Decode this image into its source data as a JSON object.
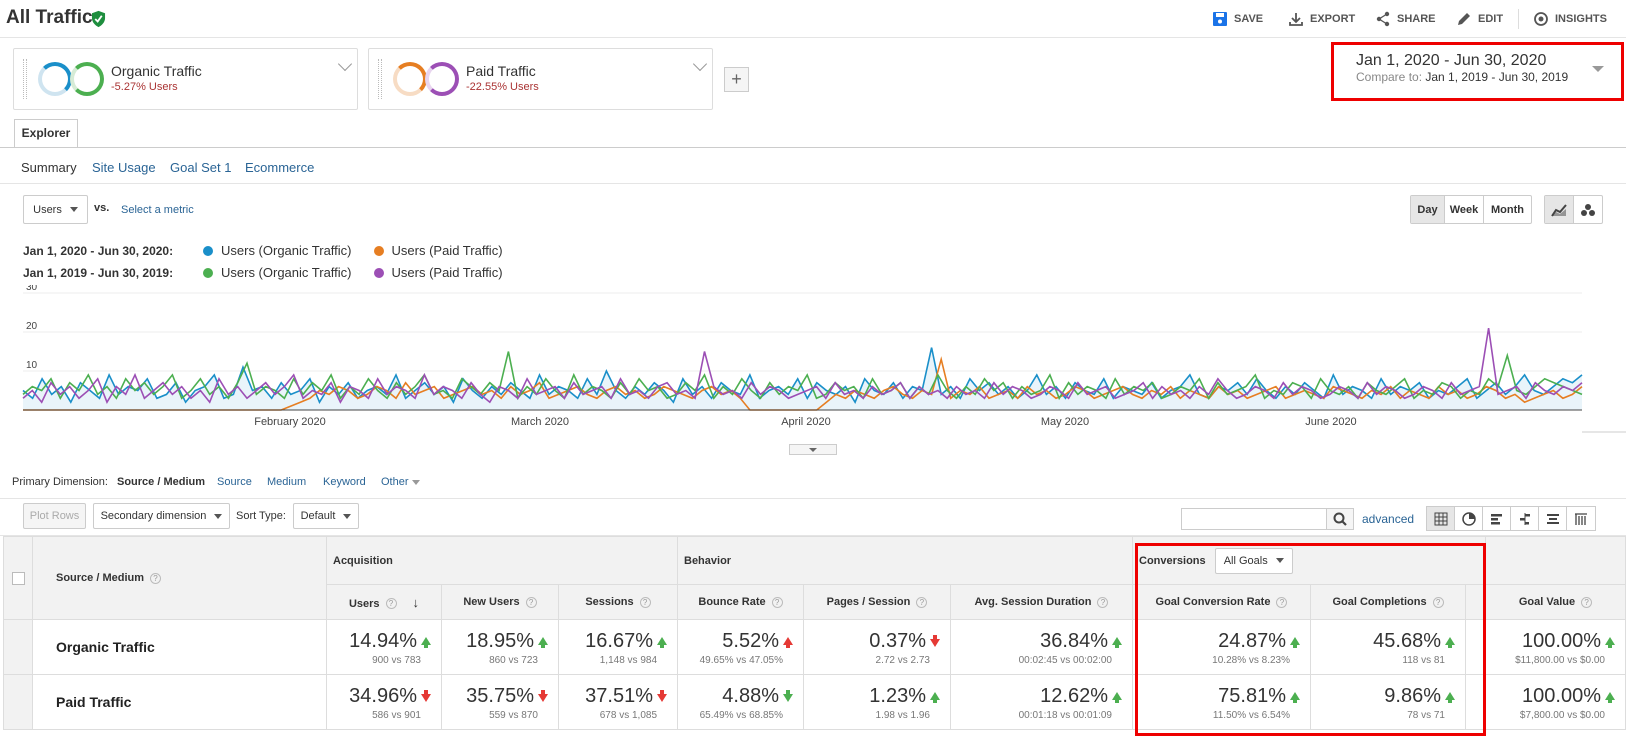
{
  "header": {
    "title": "All Traffic",
    "actions": [
      {
        "label": "SAVE",
        "icon": "save-icon"
      },
      {
        "label": "EXPORT",
        "icon": "export-icon"
      },
      {
        "label": "SHARE",
        "icon": "share-icon"
      },
      {
        "label": "EDIT",
        "icon": "edit-icon"
      },
      {
        "label": "INSIGHTS",
        "icon": "insights-icon"
      }
    ]
  },
  "segments": [
    {
      "name": "Organic Traffic",
      "delta": "-5.27% Users",
      "colors": [
        "#1a8fc9",
        "#4caf50"
      ]
    },
    {
      "name": "Paid Traffic",
      "delta": "-22.55% Users",
      "colors": [
        "#e67e22",
        "#9c4fb5"
      ]
    }
  ],
  "add_segment": "+",
  "date_range": {
    "primary": "Jan 1, 2020 - Jun 30, 2020",
    "compare_label": "Compare to:",
    "compare": "Jan 1, 2019 - Jun 30, 2019"
  },
  "explorer_tab": "Explorer",
  "subtabs": [
    "Summary",
    "Site Usage",
    "Goal Set 1",
    "Ecommerce"
  ],
  "metric_select": "Users",
  "vs_label": "vs.",
  "select_metric": "Select a metric",
  "granularity": [
    "Day",
    "Week",
    "Month"
  ],
  "legend": [
    {
      "range": "Jan 1, 2020 - Jun 30, 2020:",
      "items": [
        {
          "label": "Users (Organic Traffic)",
          "color": "#1a8fc9"
        },
        {
          "label": "Users (Paid Traffic)",
          "color": "#e67e22"
        }
      ]
    },
    {
      "range": "Jan 1, 2019 - Jun 30, 2019:",
      "items": [
        {
          "label": "Users (Organic Traffic)",
          "color": "#4caf50"
        },
        {
          "label": "Users (Paid Traffic)",
          "color": "#9c4fb5"
        }
      ]
    }
  ],
  "chart_data": {
    "type": "line",
    "ylim": [
      0,
      30
    ],
    "yticks": [
      "30",
      "20",
      "10"
    ],
    "x_labels": [
      "February 2020",
      "March 2020",
      "April 2020",
      "May 2020",
      "June 2020"
    ],
    "series": [
      {
        "name": "Users (Organic Traffic)",
        "color": "#1a8fc9",
        "values": [
          5,
          3,
          8,
          4,
          6,
          2,
          7,
          5,
          3,
          9,
          4,
          6,
          5,
          8,
          3,
          4,
          7,
          2,
          5,
          6,
          9,
          3,
          4,
          11,
          5,
          6,
          3,
          7,
          4,
          5,
          8,
          2,
          6,
          4,
          7,
          3,
          5,
          6,
          4,
          9,
          3,
          5,
          7,
          4,
          6,
          2,
          8,
          5,
          3,
          6,
          4,
          7,
          5,
          3,
          9,
          4,
          6,
          5,
          3,
          8,
          4,
          10,
          5,
          3,
          6,
          4,
          7,
          5,
          2,
          8,
          4,
          6,
          3,
          7,
          5,
          4,
          9,
          3,
          5,
          6,
          4,
          8,
          3,
          7,
          5,
          4,
          6,
          2,
          8,
          5,
          4,
          7,
          3,
          6,
          5,
          16,
          4,
          6,
          3,
          8,
          5,
          7,
          4,
          6,
          3,
          5,
          9,
          4,
          6,
          3,
          7,
          5,
          4,
          8,
          3,
          6,
          5,
          4,
          7,
          3,
          5,
          6,
          9,
          4,
          3,
          6,
          5,
          7,
          4,
          8,
          5,
          3,
          6,
          4,
          7,
          5,
          3,
          9,
          4,
          6,
          5,
          3,
          8,
          4,
          6,
          5,
          7,
          3,
          5,
          4,
          6,
          8,
          3,
          5,
          7,
          4,
          6,
          9,
          5,
          4,
          6,
          8,
          7,
          9
        ]
      },
      {
        "name": "Users (Paid Traffic)",
        "color": "#e67e22",
        "values": [
          0,
          0,
          0,
          0,
          0,
          0,
          0,
          0,
          0,
          0,
          0,
          0,
          0,
          0,
          0,
          0,
          0,
          0,
          0,
          0,
          0,
          0,
          0,
          0,
          0,
          0,
          0,
          0,
          1,
          2,
          3,
          5,
          4,
          6,
          5,
          3,
          4,
          6,
          5,
          3,
          7,
          4,
          5,
          6,
          3,
          4,
          5,
          6,
          4,
          5,
          3,
          6,
          4,
          5,
          7,
          3,
          4,
          5,
          6,
          4,
          3,
          5,
          6,
          4,
          5,
          3,
          4,
          6,
          5,
          4,
          3,
          5,
          6,
          4,
          5,
          3,
          0,
          0,
          0,
          0,
          0,
          0,
          0,
          0,
          2,
          4,
          3,
          5,
          4,
          3,
          5,
          6,
          4,
          3,
          5,
          4,
          13,
          3,
          5,
          4,
          6,
          3,
          4,
          5,
          3,
          6,
          4,
          5,
          3,
          4,
          6,
          5,
          3,
          4,
          5,
          6,
          4,
          3,
          5,
          4,
          6,
          3,
          5,
          4,
          3,
          6,
          4,
          5,
          3,
          4,
          5,
          6,
          3,
          4,
          5,
          4,
          3,
          6,
          5,
          4,
          3,
          5,
          4,
          6,
          3,
          5,
          4,
          3,
          6,
          4,
          5,
          3,
          4,
          6,
          5,
          3,
          4,
          2,
          3,
          4,
          5,
          3,
          4,
          6
        ]
      },
      {
        "name": "Users (Organic Traffic)",
        "color": "#4caf50",
        "values": [
          4,
          6,
          5,
          8,
          3,
          7,
          5,
          9,
          4,
          6,
          3,
          8,
          5,
          7,
          4,
          6,
          9,
          3,
          5,
          8,
          4,
          6,
          3,
          7,
          12,
          4,
          6,
          5,
          3,
          8,
          4,
          7,
          5,
          9,
          3,
          6,
          4,
          8,
          5,
          3,
          7,
          4,
          6,
          9,
          4,
          5,
          3,
          8,
          6,
          4,
          7,
          5,
          15,
          3,
          6,
          4,
          8,
          5,
          3,
          9,
          4,
          6,
          5,
          3,
          7,
          4,
          8,
          5,
          6,
          3,
          4,
          7,
          5,
          9,
          3,
          6,
          4,
          8,
          5,
          3,
          7,
          4,
          6,
          5,
          9,
          3,
          4,
          7,
          5,
          6,
          3,
          8,
          4,
          5,
          7,
          3,
          6,
          4,
          9,
          5,
          3,
          6,
          4,
          8,
          5,
          7,
          3,
          6,
          4,
          5,
          9,
          3,
          7,
          4,
          6,
          5,
          3,
          8,
          4,
          6,
          5,
          7,
          3,
          4,
          6,
          5,
          8,
          3,
          7,
          4,
          5,
          6,
          9,
          3,
          5,
          4,
          7,
          6,
          3,
          8,
          5,
          4,
          6,
          3,
          7,
          5,
          4,
          6,
          8,
          3,
          5,
          4,
          7,
          6,
          3,
          5,
          4,
          8,
          6,
          14,
          5,
          4,
          6,
          8,
          7,
          6,
          5,
          4
        ]
      },
      {
        "name": "Users (Paid Traffic)",
        "color": "#9c4fb5",
        "values": [
          3,
          5,
          2,
          7,
          4,
          6,
          3,
          5,
          8,
          2,
          6,
          4,
          9,
          3,
          5,
          7,
          4,
          6,
          3,
          5,
          2,
          8,
          4,
          6,
          3,
          5,
          7,
          4,
          6,
          9,
          3,
          5,
          4,
          7,
          2,
          6,
          5,
          3,
          8,
          4,
          6,
          5,
          3,
          9,
          4,
          6,
          5,
          3,
          7,
          4,
          2,
          6,
          5,
          3,
          8,
          4,
          5,
          6,
          3,
          7,
          4,
          5,
          6,
          3,
          8,
          4,
          5,
          3,
          6,
          7,
          4,
          5,
          3,
          15,
          6,
          4,
          5,
          3,
          7,
          4,
          6,
          5,
          3,
          4,
          5,
          6,
          3,
          7,
          4,
          5,
          3,
          6,
          4,
          5,
          7,
          3,
          6,
          4,
          5,
          3,
          6,
          4,
          5,
          3,
          7,
          4,
          6,
          5,
          3,
          4,
          6,
          5,
          3,
          7,
          4,
          5,
          6,
          3,
          4,
          5,
          7,
          3,
          6,
          4,
          5,
          3,
          6,
          4,
          8,
          5,
          3,
          4,
          6,
          5,
          3,
          7,
          4,
          6,
          5,
          3,
          4,
          6,
          5,
          3,
          7,
          4,
          6,
          5,
          3,
          4,
          6,
          5,
          3,
          7,
          4,
          5,
          6,
          21,
          4,
          5,
          6,
          3,
          7,
          5,
          4,
          6,
          5,
          7
        ]
      }
    ]
  },
  "primary_dimension": {
    "label": "Primary Dimension:",
    "active": "Source / Medium",
    "options": [
      "Source",
      "Medium",
      "Keyword",
      "Other"
    ]
  },
  "table_controls": {
    "plot_rows": "Plot Rows",
    "secondary_dimension": "Secondary dimension",
    "sort_type_label": "Sort Type:",
    "sort_type": "Default",
    "advanced": "advanced"
  },
  "table": {
    "dimension_header": "Source / Medium",
    "group_acquisition": "Acquisition",
    "group_behavior": "Behavior",
    "group_conversions": "Conversions",
    "goal_select": "All Goals",
    "columns": [
      "Users",
      "New Users",
      "Sessions",
      "Bounce Rate",
      "Pages / Session",
      "Avg. Session Duration",
      "Goal Conversion Rate",
      "Goal Completions",
      "Goal Value"
    ],
    "rows": [
      {
        "name": "Organic Traffic",
        "cells": [
          {
            "pct": "14.94%",
            "dir": "up",
            "sub": "900 vs 783"
          },
          {
            "pct": "18.95%",
            "dir": "up",
            "sub": "860 vs 723"
          },
          {
            "pct": "16.67%",
            "dir": "up",
            "sub": "1,148 vs 984"
          },
          {
            "pct": "5.52%",
            "dir": "upred",
            "sub": "49.65% vs 47.05%"
          },
          {
            "pct": "0.37%",
            "dir": "down",
            "sub": "2.72 vs 2.73"
          },
          {
            "pct": "36.84%",
            "dir": "up",
            "sub": "00:02:45 vs 00:02:00"
          },
          {
            "pct": "24.87%",
            "dir": "up",
            "sub": "10.28% vs 8.23%"
          },
          {
            "pct": "45.68%",
            "dir": "up",
            "sub": "118 vs 81"
          },
          {
            "pct": "100.00%",
            "dir": "up",
            "sub": "$11,800.00 vs $0.00"
          }
        ]
      },
      {
        "name": "Paid Traffic",
        "cells": [
          {
            "pct": "34.96%",
            "dir": "down",
            "sub": "586 vs 901"
          },
          {
            "pct": "35.75%",
            "dir": "down",
            "sub": "559 vs 870"
          },
          {
            "pct": "37.51%",
            "dir": "down",
            "sub": "678 vs 1,085"
          },
          {
            "pct": "4.88%",
            "dir": "downgreen",
            "sub": "65.49% vs 68.85%"
          },
          {
            "pct": "1.23%",
            "dir": "up",
            "sub": "1.98 vs 1.96"
          },
          {
            "pct": "12.62%",
            "dir": "up",
            "sub": "00:01:18 vs 00:01:09"
          },
          {
            "pct": "75.81%",
            "dir": "up",
            "sub": "11.50% vs 6.54%"
          },
          {
            "pct": "9.86%",
            "dir": "up",
            "sub": "78 vs 71"
          },
          {
            "pct": "100.00%",
            "dir": "up",
            "sub": "$7,800.00 vs $0.00"
          }
        ]
      }
    ]
  }
}
